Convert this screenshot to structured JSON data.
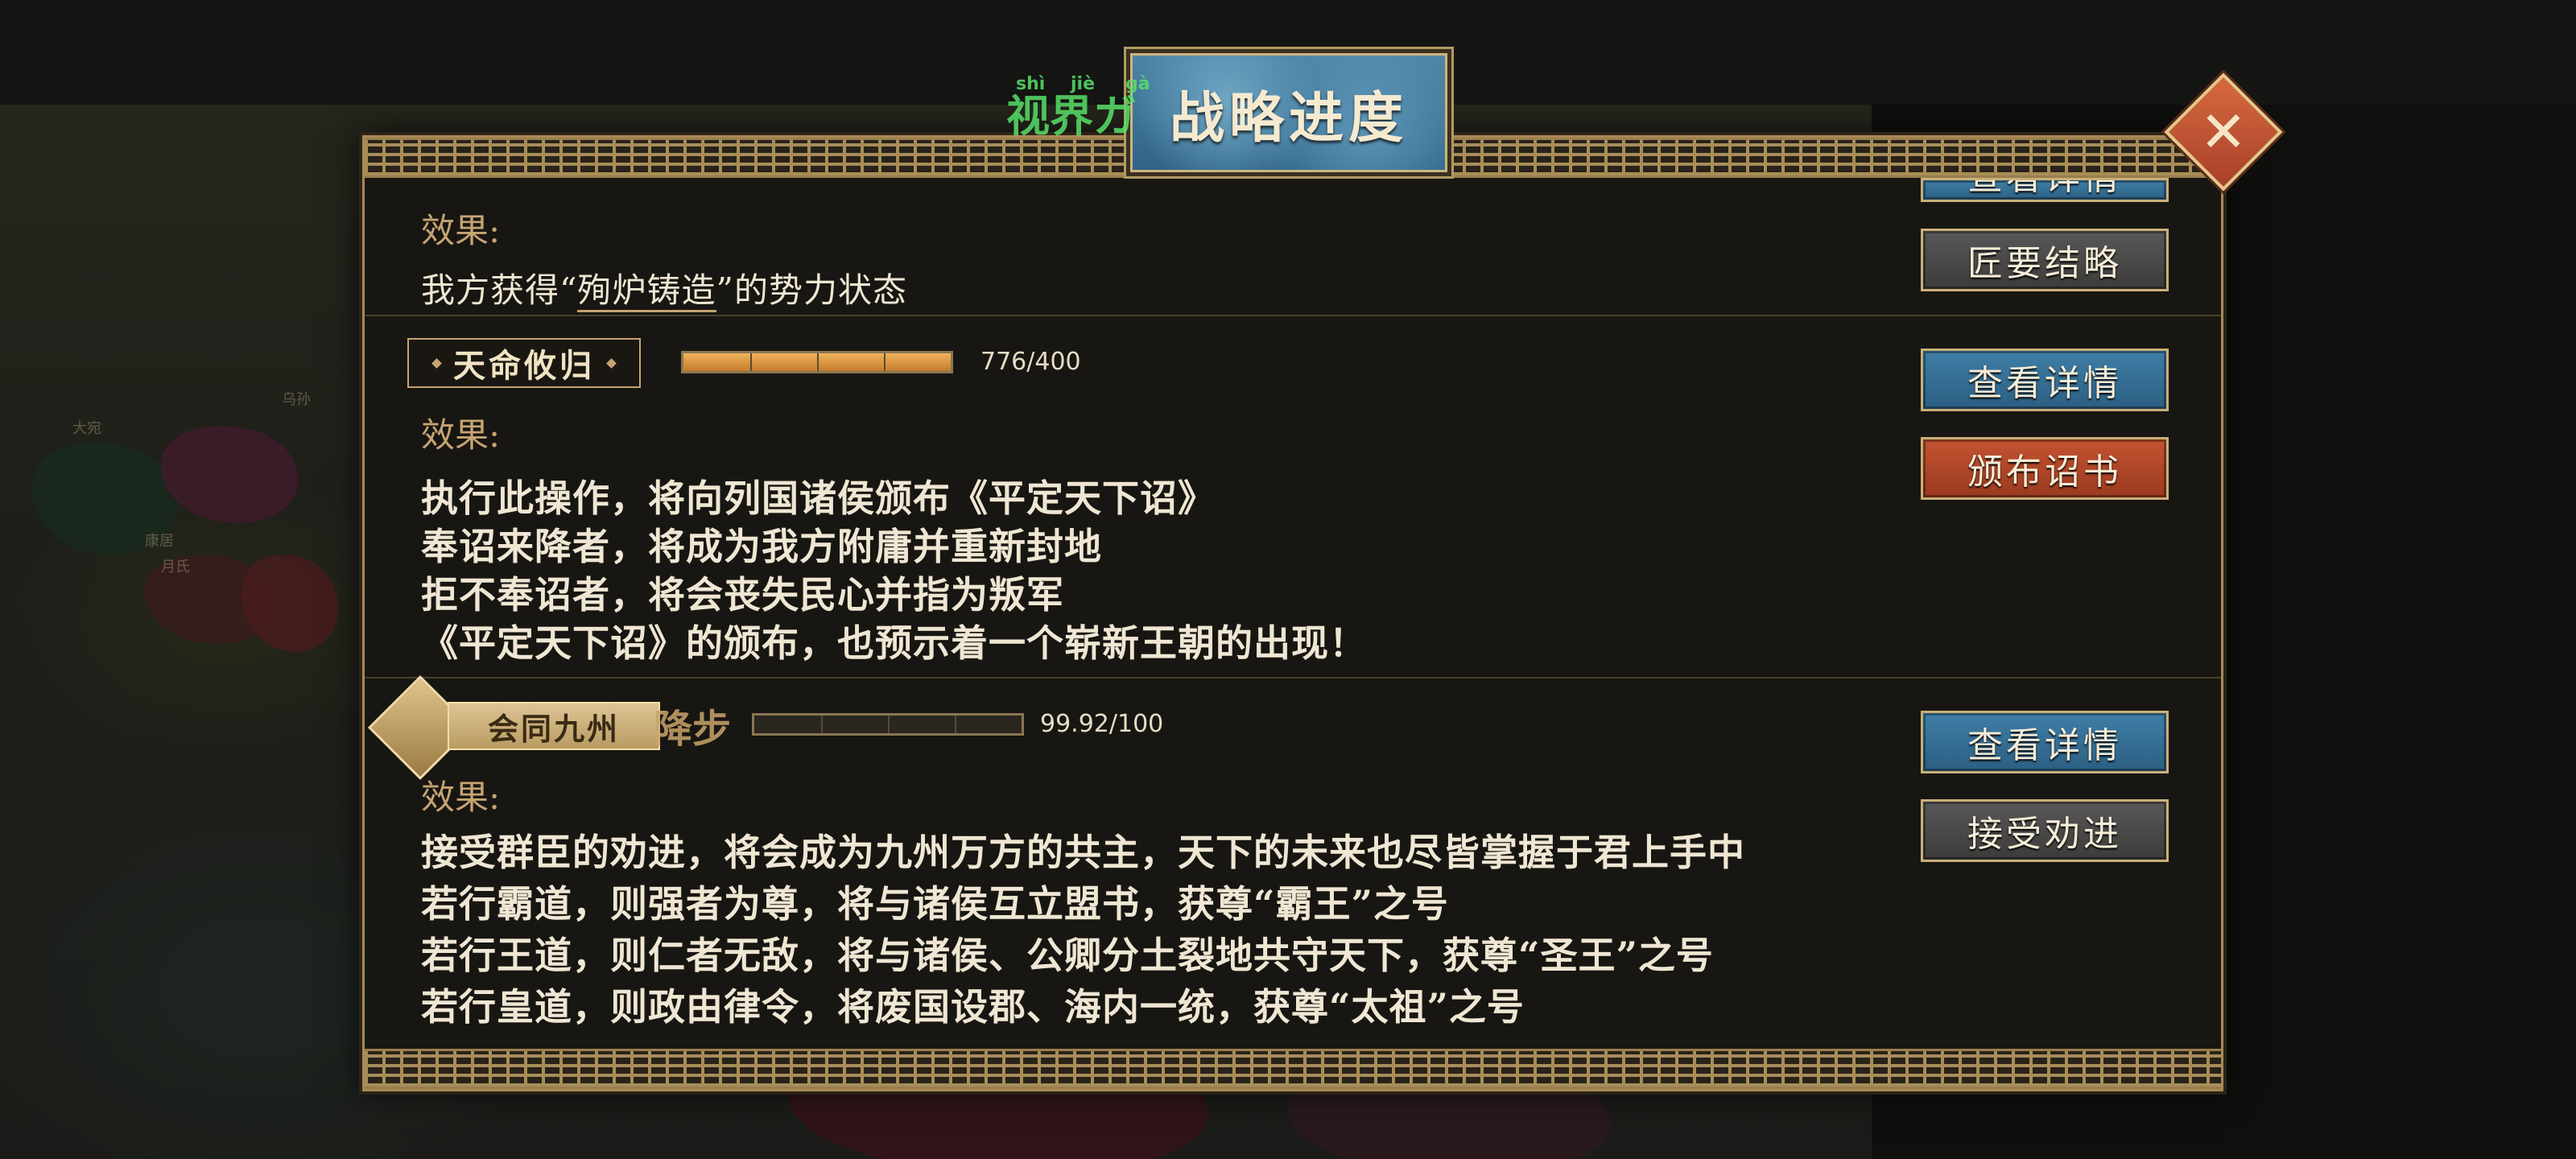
{
  "title": "战略进度",
  "overlay": {
    "text": "视界ガ",
    "pinyin": [
      "shì",
      "jiè",
      "ɡà"
    ]
  },
  "colors": {
    "accent_gold": "#c5a473",
    "button_blue": "#2b5f82",
    "button_red": "#9a3a20",
    "button_gray": "#3c3b3a",
    "progress_orange": "#e39a44"
  },
  "icons": {
    "close": "close-icon",
    "tag_diamond": "diamond-icon",
    "emblem": "emblem-icon"
  },
  "section1": {
    "effect_label": "效果:",
    "line_prefix": "我方获得“",
    "line_status": "殉炉铸造",
    "line_suffix": "”的势力状态",
    "buttons": {
      "top_partial": "查看详情",
      "secondary": "匠要结略"
    }
  },
  "section2": {
    "tag": "天命攸归",
    "progress": {
      "current": 776,
      "max": 400,
      "text": "776/400",
      "fill": 1.0
    },
    "effect_label": "效果:",
    "lines": [
      "执行此操作，将向列国诸侯颁布《平定天下诏》",
      "奉诏来降者，将成为我方附庸并重新封地",
      "拒不奉诏者，将会丧失民心并指为叛军",
      "《平定天下诏》的颁布，也预示着一个崭新王朝的出现！"
    ],
    "buttons": {
      "details": "查看详情",
      "action": "颁布诏书"
    }
  },
  "section3": {
    "tag": "会同九州",
    "seal": "降步",
    "progress": {
      "current": 99.92,
      "max": 100,
      "text": "99.92/100",
      "fill": 0.0
    },
    "effect_label": "效果:",
    "lines": [
      "接受群臣的劝进，将会成为九州万方的共主，天下的未来也尽皆掌握于君上手中",
      "若行霸道，则强者为尊，将与诸侯互立盟书，获尊“霸王”之号",
      "若行王道，则仁者无敌，将与诸侯、公卿分土裂地共守天下，获尊“圣王”之号",
      "若行皇道，则政由律令，将废国设郡、海内一统，获尊“太祖”之号"
    ],
    "buttons": {
      "details": "查看详情",
      "action": "接受劝进"
    }
  },
  "map_labels": [
    "乌孙",
    "大宛",
    "康居",
    "月氏"
  ]
}
